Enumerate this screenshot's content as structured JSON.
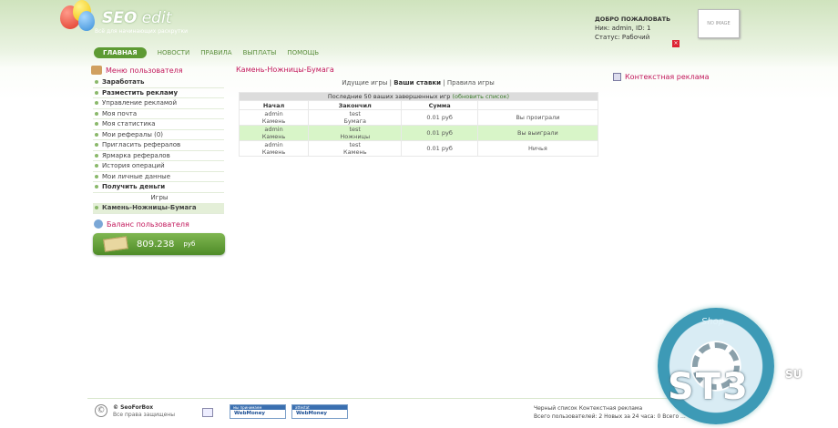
{
  "header": {
    "logo": "SEO",
    "logo_suffix": " edit",
    "slogan": "Всё для начинающих раскрутки",
    "welcome_title": "ДОБРО ПОЖАЛОВАТЬ",
    "user_line": "Ник: admin, ID: 1",
    "status_line": "Статус: Рабочий",
    "avatar_text": "NO IMAGE",
    "logout_icon": "close-icon"
  },
  "nav": {
    "items": [
      "ГЛАВНАЯ",
      "НОВОСТИ",
      "ПРАВИЛА",
      "ВЫПЛАТЫ",
      "ПОМОЩЬ"
    ]
  },
  "sidebar": {
    "title": "Меню пользователя",
    "items": [
      {
        "label": "Заработать",
        "bold": true
      },
      {
        "label": "Разместить рекламу",
        "bold": true
      },
      {
        "label": "Управление рекламой"
      },
      {
        "label": "Моя почта"
      },
      {
        "label": "Моя статистика"
      },
      {
        "label": "Мои рефералы (0)"
      },
      {
        "label": "Пригласить рефералов"
      },
      {
        "label": "Ярмарка рефералов"
      },
      {
        "label": "История операций"
      },
      {
        "label": "Мои личные данные"
      },
      {
        "label": "Получить деньги",
        "bold": true
      },
      {
        "label": "Игры",
        "sub": true
      },
      {
        "label": "Камень-Ножницы-Бумага",
        "current": true
      }
    ],
    "balance_title": "Баланс пользователя",
    "balance_value": "809.238",
    "balance_unit": "руб"
  },
  "main": {
    "title": "Камень-Ножницы-Бумага",
    "tabs": [
      "Идущие игры",
      "Ваши ставки",
      "Правила игры"
    ],
    "table_caption": "Последние 50 ваших завершенных игр",
    "table_refresh": "(обновить список)",
    "columns": [
      "Начал",
      "Закончил",
      "Сумма",
      ""
    ],
    "rows": [
      {
        "started": "admin",
        "started_move": "Камень",
        "ended": "test",
        "ended_move": "Бумага",
        "sum": "0.01 руб",
        "result": "Вы проиграли"
      },
      {
        "started": "admin",
        "started_move": "Камень",
        "ended": "test",
        "ended_move": "Ножницы",
        "sum": "0.01 руб",
        "result": "Вы выиграли"
      },
      {
        "started": "admin",
        "started_move": "Камень",
        "ended": "test",
        "ended_move": "Камень",
        "sum": "0.01 руб",
        "result": "Ничья"
      }
    ]
  },
  "right": {
    "context_ads": "Контекстная реклама"
  },
  "footer": {
    "copyright": "© SeoForBox",
    "rights": "Все права защищены",
    "wm1_top": "мы принимаем",
    "wm1_bottom": "WebMoney",
    "wm2_top": "attestat",
    "wm2_bottom": "WebMoney",
    "right_line1": "Черный список    Контекстная реклама",
    "right_line2": "Всего пользователей: 2   Новых за 24 часа: 0   Всего ...",
    "watermark_main": "ST3",
    "watermark_suffix": "SU",
    "watermark_shop": "Shop"
  },
  "colors": {
    "accent": "#5d9a33",
    "title_pink": "#c2185b",
    "win_row": "#d8f5c8"
  }
}
